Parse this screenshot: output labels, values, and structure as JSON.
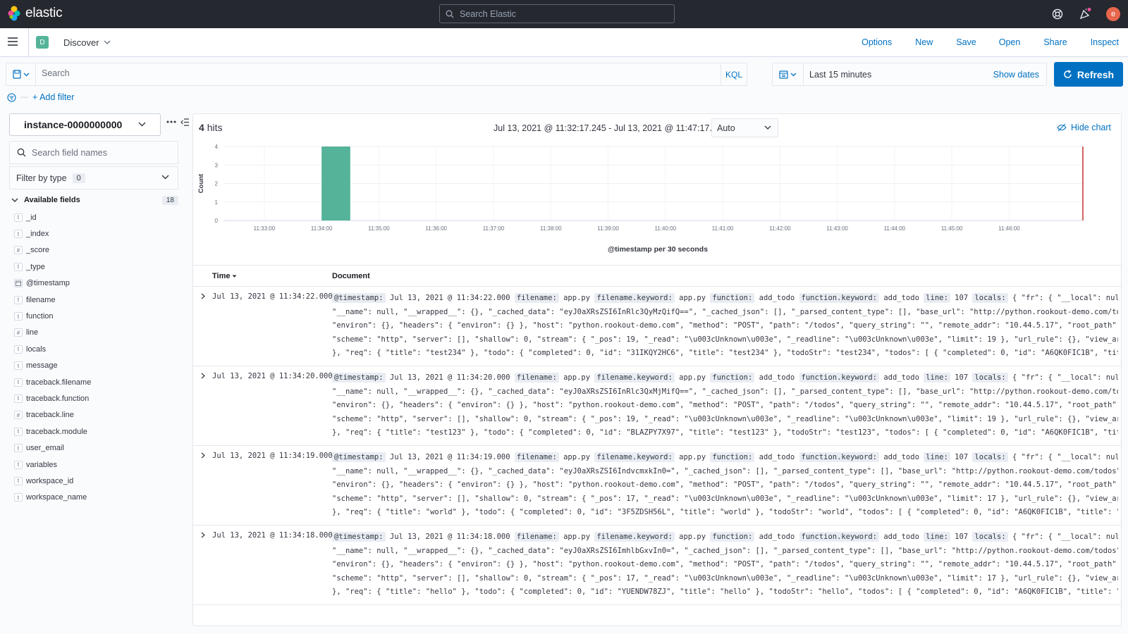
{
  "header": {
    "logo_text": "elastic",
    "search_placeholder": "Search Elastic",
    "avatar_letter": "e"
  },
  "app_bar": {
    "space_letter": "D",
    "app_name": "Discover",
    "nav": [
      "Options",
      "New",
      "Save",
      "Open",
      "Share",
      "Inspect"
    ]
  },
  "query": {
    "placeholder": "Search",
    "language": "KQL",
    "date_range": "Last 15 minutes",
    "show_dates": "Show dates",
    "refresh_label": "Refresh"
  },
  "filter": {
    "add_filter": "+ Add filter"
  },
  "sidebar": {
    "index_pattern": "instance-0000000000",
    "field_search_placeholder": "Search field names",
    "filter_by_type": "Filter by type",
    "filter_count": "0",
    "available_label": "Available fields",
    "available_count": "18",
    "fields": [
      {
        "type": "t",
        "name": "_id"
      },
      {
        "type": "t",
        "name": "_index"
      },
      {
        "type": "#",
        "name": "_score"
      },
      {
        "type": "t",
        "name": "_type"
      },
      {
        "type": "date",
        "name": "@timestamp"
      },
      {
        "type": "t",
        "name": "filename"
      },
      {
        "type": "t",
        "name": "function"
      },
      {
        "type": "#",
        "name": "line"
      },
      {
        "type": "t",
        "name": "locals"
      },
      {
        "type": "t",
        "name": "message"
      },
      {
        "type": "t",
        "name": "traceback.filename"
      },
      {
        "type": "t",
        "name": "traceback.function"
      },
      {
        "type": "#",
        "name": "traceback.line"
      },
      {
        "type": "t",
        "name": "traceback.module"
      },
      {
        "type": "t",
        "name": "user_email"
      },
      {
        "type": "t",
        "name": "variables"
      },
      {
        "type": "t",
        "name": "workspace_id"
      },
      {
        "type": "t",
        "name": "workspace_name"
      }
    ]
  },
  "results": {
    "hits_count": "4",
    "hits_label": "hits",
    "time_span": "Jul 13, 2021 @ 11:32:17.245 - Jul 13, 2021 @ 11:47:17.245",
    "interval": "Auto",
    "hide_chart": "Hide chart",
    "col_time": "Time",
    "col_document": "Document"
  },
  "chart_data": {
    "type": "bar",
    "title": "",
    "xlabel": "@timestamp per 30 seconds",
    "ylabel": "Count",
    "ylim": [
      0,
      4
    ],
    "yticks": [
      0,
      1,
      2,
      3,
      4
    ],
    "xticks": [
      "11:33:00",
      "11:34:00",
      "11:35:00",
      "11:36:00",
      "11:37:00",
      "11:38:00",
      "11:39:00",
      "11:40:00",
      "11:41:00",
      "11:42:00",
      "11:43:00",
      "11:44:00",
      "11:45:00",
      "11:46:00"
    ],
    "x_range": [
      "11:32:17.245",
      "11:47:17.245"
    ],
    "bars": [
      {
        "x": "11:34:00",
        "count": 4
      }
    ],
    "now_marker": "11:47:17.245",
    "bar_color": "#54b399",
    "marker_color": "#bd271e"
  },
  "rows": [
    {
      "time": "Jul 13, 2021 @ 11:34:22.000",
      "lines": [
        [
          [
            "k",
            "@timestamp:"
          ],
          [
            "v",
            " Jul 13, 2021 @ 11:34:22.000 "
          ],
          [
            "k",
            "filename:"
          ],
          [
            "v",
            " app.py "
          ],
          [
            "k",
            "filename.keyword:"
          ],
          [
            "v",
            " app.py "
          ],
          [
            "k",
            "function:"
          ],
          [
            "v",
            " add_todo "
          ],
          [
            "k",
            "function.keyword:"
          ],
          [
            "v",
            " add_todo "
          ],
          [
            "k",
            "line:"
          ],
          [
            "v",
            " 107 "
          ],
          [
            "k",
            "locals:"
          ],
          [
            "v",
            " { \"fr\": { \"__local\": null,"
          ]
        ],
        [
          [
            "v",
            "\"__name\": null, \"__wrapped__\": {}, \"_cached_data\": \"eyJ0aXRsZSI6InRlc3QyMzQifQ==\", \"_cached_json\": [], \"_parsed_content_type\": [], \"base_url\": \"http://python.rookout-demo.com/todos\","
          ]
        ],
        [
          [
            "v",
            "\"environ\": {}, \"headers\": { \"environ\": {} }, \"host\": \"python.rookout-demo.com\", \"method\": \"POST\", \"path\": \"/todos\", \"query_string\": \"\", \"remote_addr\": \"10.44.5.17\", \"root_path\": \"\","
          ]
        ],
        [
          [
            "v",
            "\"scheme\": \"http\", \"server\": [], \"shallow\": 0, \"stream\": { \"_pos\": 19, \"_read\": \"\\u003cUnknown\\u003e\", \"_readline\": \"\\u003cUnknown\\u003e\", \"limit\": 19 }, \"url_rule\": {}, \"view_args\": {}"
          ]
        ],
        [
          [
            "v",
            "}, \"req\": { \"title\": \"test234\" }, \"todo\": { \"completed\": 0, \"id\": \"31IKQY2HC6\", \"title\": \"test234\" }, \"todoStr\": \"test234\", \"todos\": [ { \"completed\": 0, \"id\": \"A6QK0FIC1B\", \"title\": \"hi\""
          ]
        ]
      ]
    },
    {
      "time": "Jul 13, 2021 @ 11:34:20.000",
      "lines": [
        [
          [
            "k",
            "@timestamp:"
          ],
          [
            "v",
            " Jul 13, 2021 @ 11:34:20.000 "
          ],
          [
            "k",
            "filename:"
          ],
          [
            "v",
            " app.py "
          ],
          [
            "k",
            "filename.keyword:"
          ],
          [
            "v",
            " app.py "
          ],
          [
            "k",
            "function:"
          ],
          [
            "v",
            " add_todo "
          ],
          [
            "k",
            "function.keyword:"
          ],
          [
            "v",
            " add_todo "
          ],
          [
            "k",
            "line:"
          ],
          [
            "v",
            " 107 "
          ],
          [
            "k",
            "locals:"
          ],
          [
            "v",
            " { \"fr\": { \"__local\": null,"
          ]
        ],
        [
          [
            "v",
            "\"__name\": null, \"__wrapped__\": {}, \"_cached_data\": \"eyJ0aXRsZSI6InRlc3QxMjMifQ==\", \"_cached_json\": [], \"_parsed_content_type\": [], \"base_url\": \"http://python.rookout-demo.com/todos\","
          ]
        ],
        [
          [
            "v",
            "\"environ\": {}, \"headers\": { \"environ\": {} }, \"host\": \"python.rookout-demo.com\", \"method\": \"POST\", \"path\": \"/todos\", \"query_string\": \"\", \"remote_addr\": \"10.44.5.17\", \"root_path\": \"\","
          ]
        ],
        [
          [
            "v",
            "\"scheme\": \"http\", \"server\": [], \"shallow\": 0, \"stream\": { \"_pos\": 19, \"_read\": \"\\u003cUnknown\\u003e\", \"_readline\": \"\\u003cUnknown\\u003e\", \"limit\": 19 }, \"url_rule\": {}, \"view_args\": {}"
          ]
        ],
        [
          [
            "v",
            "}, \"req\": { \"title\": \"test123\" }, \"todo\": { \"completed\": 0, \"id\": \"BLAZPY7X97\", \"title\": \"test123\" }, \"todoStr\": \"test123\", \"todos\": [ { \"completed\": 0, \"id\": \"A6QK0FIC1B\", \"title\": \"hi\""
          ]
        ]
      ]
    },
    {
      "time": "Jul 13, 2021 @ 11:34:19.000",
      "lines": [
        [
          [
            "k",
            "@timestamp:"
          ],
          [
            "v",
            " Jul 13, 2021 @ 11:34:19.000 "
          ],
          [
            "k",
            "filename:"
          ],
          [
            "v",
            " app.py "
          ],
          [
            "k",
            "filename.keyword:"
          ],
          [
            "v",
            " app.py "
          ],
          [
            "k",
            "function:"
          ],
          [
            "v",
            " add_todo "
          ],
          [
            "k",
            "function.keyword:"
          ],
          [
            "v",
            " add_todo "
          ],
          [
            "k",
            "line:"
          ],
          [
            "v",
            " 107 "
          ],
          [
            "k",
            "locals:"
          ],
          [
            "v",
            " { \"fr\": { \"__local\": null,"
          ]
        ],
        [
          [
            "v",
            "\"__name\": null, \"__wrapped__\": {}, \"_cached_data\": \"eyJ0aXRsZSI6IndvcmxkIn0=\", \"_cached_json\": [], \"_parsed_content_type\": [], \"base_url\": \"http://python.rookout-demo.com/todos\","
          ]
        ],
        [
          [
            "v",
            "\"environ\": {}, \"headers\": { \"environ\": {} }, \"host\": \"python.rookout-demo.com\", \"method\": \"POST\", \"path\": \"/todos\", \"query_string\": \"\", \"remote_addr\": \"10.44.5.17\", \"root_path\": \"\","
          ]
        ],
        [
          [
            "v",
            "\"scheme\": \"http\", \"server\": [], \"shallow\": 0, \"stream\": { \"_pos\": 17, \"_read\": \"\\u003cUnknown\\u003e\", \"_readline\": \"\\u003cUnknown\\u003e\", \"limit\": 17 }, \"url_rule\": {}, \"view_args\": {}"
          ]
        ],
        [
          [
            "v",
            "}, \"req\": { \"title\": \"world\" }, \"todo\": { \"completed\": 0, \"id\": \"3F5ZDSH56L\", \"title\": \"world\" }, \"todoStr\": \"world\", \"todos\": [ { \"completed\": 0, \"id\": \"A6QK0FIC1B\", \"title\": \"hi\" }, {"
          ]
        ]
      ]
    },
    {
      "time": "Jul 13, 2021 @ 11:34:18.000",
      "lines": [
        [
          [
            "k",
            "@timestamp:"
          ],
          [
            "v",
            " Jul 13, 2021 @ 11:34:18.000 "
          ],
          [
            "k",
            "filename:"
          ],
          [
            "v",
            " app.py "
          ],
          [
            "k",
            "filename.keyword:"
          ],
          [
            "v",
            " app.py "
          ],
          [
            "k",
            "function:"
          ],
          [
            "v",
            " add_todo "
          ],
          [
            "k",
            "function.keyword:"
          ],
          [
            "v",
            " add_todo "
          ],
          [
            "k",
            "line:"
          ],
          [
            "v",
            " 107 "
          ],
          [
            "k",
            "locals:"
          ],
          [
            "v",
            " { \"fr\": { \"__local\": null,"
          ]
        ],
        [
          [
            "v",
            "\"__name\": null, \"__wrapped__\": {}, \"_cached_data\": \"eyJ0aXRsZSI6ImhlbGxvIn0=\", \"_cached_json\": [], \"_parsed_content_type\": [], \"base_url\": \"http://python.rookout-demo.com/todos\","
          ]
        ],
        [
          [
            "v",
            "\"environ\": {}, \"headers\": { \"environ\": {} }, \"host\": \"python.rookout-demo.com\", \"method\": \"POST\", \"path\": \"/todos\", \"query_string\": \"\", \"remote_addr\": \"10.44.5.17\", \"root_path\": \"\","
          ]
        ],
        [
          [
            "v",
            "\"scheme\": \"http\", \"server\": [], \"shallow\": 0, \"stream\": { \"_pos\": 17, \"_read\": \"\\u003cUnknown\\u003e\", \"_readline\": \"\\u003cUnknown\\u003e\", \"limit\": 17 }, \"url_rule\": {}, \"view_args\": {}"
          ]
        ],
        [
          [
            "v",
            "}, \"req\": { \"title\": \"hello\" }, \"todo\": { \"completed\": 0, \"id\": \"YUENDW78ZJ\", \"title\": \"hello\" }, \"todoStr\": \"hello\", \"todos\": [ { \"completed\": 0, \"id\": \"A6QK0FIC1B\", \"title\": \"hi\" }, {"
          ]
        ]
      ]
    }
  ],
  "colors": {
    "header_bg": "#25282f",
    "link": "#0071c2",
    "primary_button": "#0071c2",
    "space_badge": "#54b399",
    "avatar": "#e7664c"
  }
}
